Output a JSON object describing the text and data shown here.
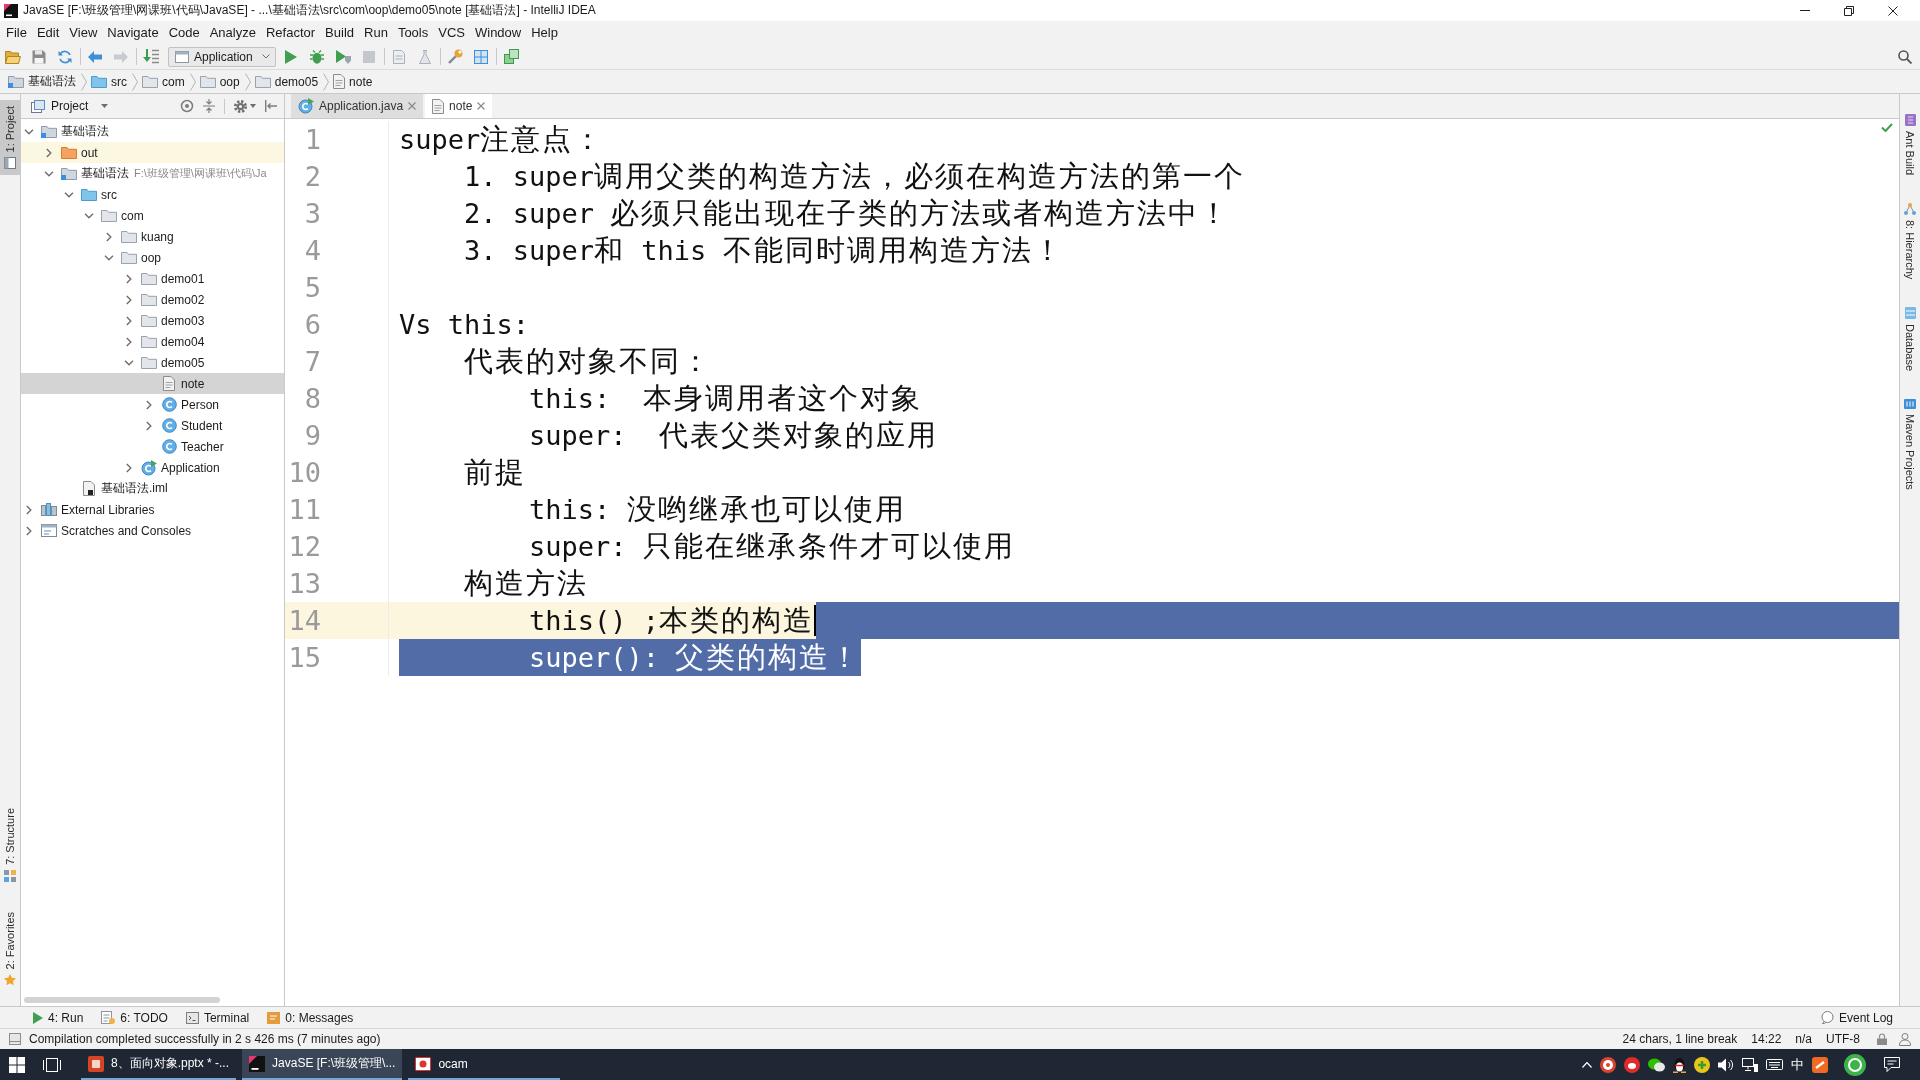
{
  "window": {
    "title": "JavaSE [F:\\班级管理\\网课班\\代码\\JavaSE] - ...\\基础语法\\src\\com\\oop\\demo05\\note [基础语法] - IntelliJ IDEA"
  },
  "menu": [
    "File",
    "Edit",
    "View",
    "Navigate",
    "Code",
    "Analyze",
    "Refactor",
    "Build",
    "Run",
    "Tools",
    "VCS",
    "Window",
    "Help"
  ],
  "toolbar": {
    "run_configuration": "Application"
  },
  "breadcrumbs": [
    {
      "label": "基础语法",
      "kind": "module"
    },
    {
      "label": "src",
      "kind": "source-folder"
    },
    {
      "label": "com",
      "kind": "folder"
    },
    {
      "label": "oop",
      "kind": "folder"
    },
    {
      "label": "demo05",
      "kind": "folder"
    },
    {
      "label": "note",
      "kind": "text-file"
    }
  ],
  "left_strip": {
    "top": [
      {
        "label": "1: Project",
        "kind": "project",
        "selected": true
      }
    ],
    "bottom": [
      {
        "label": "7: Structure",
        "kind": "structure",
        "selected": false
      },
      {
        "label": "2: Favorites",
        "kind": "favorites",
        "selected": false
      }
    ]
  },
  "project_panel": {
    "title": "Project",
    "tree": [
      {
        "label": "基础语法",
        "kind": "module",
        "selected": false,
        "expanded": true,
        "children": [
          {
            "label": "out",
            "kind": "excluded-folder",
            "selected": false,
            "expanded": false
          },
          {
            "label": "基础语法",
            "path": "F:\\班级管理\\网课班\\代码\\Ja",
            "kind": "module",
            "selected": false,
            "expanded": true,
            "children": [
              {
                "label": "src",
                "kind": "source-folder",
                "selected": false,
                "expanded": true,
                "children": [
                  {
                    "label": "com",
                    "kind": "folder",
                    "selected": false,
                    "expanded": true,
                    "children": [
                      {
                        "label": "kuang",
                        "kind": "folder",
                        "selected": false,
                        "expanded": false
                      },
                      {
                        "label": "oop",
                        "kind": "folder",
                        "selected": false,
                        "expanded": true,
                        "children": [
                          {
                            "label": "demo01",
                            "kind": "folder",
                            "selected": false,
                            "expanded": false
                          },
                          {
                            "label": "demo02",
                            "kind": "folder",
                            "selected": false,
                            "expanded": false
                          },
                          {
                            "label": "demo03",
                            "kind": "folder",
                            "selected": false,
                            "expanded": false
                          },
                          {
                            "label": "demo04",
                            "kind": "folder",
                            "selected": false,
                            "expanded": false
                          },
                          {
                            "label": "demo05",
                            "kind": "folder",
                            "selected": false,
                            "expanded": true,
                            "children": [
                              {
                                "label": "note",
                                "kind": "text-file",
                                "selected": true
                              },
                              {
                                "label": "Person",
                                "kind": "class",
                                "selected": false,
                                "expanded": false
                              },
                              {
                                "label": "Student",
                                "kind": "class",
                                "selected": false,
                                "expanded": false
                              },
                              {
                                "label": "Teacher",
                                "kind": "class",
                                "selected": false
                              }
                            ]
                          },
                          {
                            "label": "Application",
                            "kind": "main-class",
                            "selected": false,
                            "expanded": false
                          }
                        ]
                      }
                    ]
                  }
                ]
              },
              {
                "label": "基础语法.iml",
                "kind": "iml-file",
                "selected": false
              }
            ]
          }
        ]
      },
      {
        "label": "External Libraries",
        "kind": "libraries",
        "selected": false,
        "expanded": false
      },
      {
        "label": "Scratches and Consoles",
        "kind": "scratches",
        "selected": false,
        "expanded": false
      }
    ]
  },
  "editor": {
    "tabs": [
      {
        "label": "Application.java",
        "kind": "main-class",
        "selected": false
      },
      {
        "label": "note",
        "kind": "text-file",
        "selected": true
      }
    ],
    "lines": [
      {
        "number": "1",
        "text": "super注意点：",
        "current": false,
        "selected": false,
        "line_break_selected": false,
        "children": [
          {
            "number": "2",
            "text": "1. super调用父类的构造方法，必须在构造方法的第一个",
            "current": false,
            "selected": false,
            "line_break_selected": false
          },
          {
            "number": "3",
            "text": "2. super 必须只能出现在子类的方法或者构造方法中！",
            "current": false,
            "selected": false,
            "line_break_selected": false
          },
          {
            "number": "4",
            "text": "3. super和 this 不能同时调用构造方法！",
            "current": false,
            "selected": false,
            "line_break_selected": false
          }
        ]
      },
      {
        "number": "5",
        "current": false,
        "selected": false,
        "line_break_selected": false
      },
      {
        "number": "6",
        "text": "Vs this:",
        "current": false,
        "selected": false,
        "line_break_selected": false,
        "children": [
          {
            "number": "7",
            "text": "代表的对象不同：",
            "current": false,
            "selected": false,
            "line_break_selected": false,
            "children": [
              {
                "number": "8",
                "text": "this:  本身调用者这个对象",
                "current": false,
                "selected": false,
                "line_break_selected": false
              },
              {
                "number": "9",
                "text": "super:  代表父类对象的应用",
                "current": false,
                "selected": false,
                "line_break_selected": false
              }
            ]
          },
          {
            "number": "10",
            "text": "前提",
            "current": false,
            "selected": false,
            "line_break_selected": false,
            "children": [
              {
                "number": "11",
                "text": "this: 没哟继承也可以使用",
                "current": false,
                "selected": false,
                "line_break_selected": false
              },
              {
                "number": "12",
                "text": "super: 只能在继承条件才可以使用",
                "current": false,
                "selected": false,
                "line_break_selected": false
              }
            ]
          },
          {
            "number": "13",
            "text": "构造方法",
            "current": false,
            "selected": false,
            "line_break_selected": false,
            "children": [
              {
                "number": "14",
                "text": "this() ;本类的构造",
                "current": true,
                "selected": false,
                "line_break_selected": true
              },
              {
                "number": "15",
                "text": "super(): 父类的构造！",
                "current": false,
                "selected": true,
                "line_break_selected": false
              }
            ]
          }
        ]
      }
    ]
  },
  "right_strip": [
    {
      "label": "Ant Build",
      "kind": "ant"
    },
    {
      "label": "8: Hierarchy",
      "kind": "hierarchy"
    },
    {
      "label": "Database",
      "kind": "database"
    },
    {
      "label": "Maven Projects",
      "kind": "maven"
    }
  ],
  "tool_window_bar": {
    "left": [
      {
        "label": "4: Run",
        "kind": "run"
      },
      {
        "label": "6: TODO",
        "kind": "todo"
      },
      {
        "label": "Terminal",
        "kind": "terminal"
      },
      {
        "label": "0: Messages",
        "kind": "messages"
      }
    ],
    "right": [
      {
        "label": "Event Log",
        "kind": "event-log"
      }
    ]
  },
  "status_bar": {
    "message": "Compilation completed successfully in 2 s 426 ms (7 minutes ago)",
    "selection_info": "24 chars, 1 line break",
    "position": "14:22",
    "line_separator": "n/a",
    "encoding": "UTF-8"
  },
  "taskbar": {
    "apps": [
      {
        "label": "8、面向对象.pptx * -...",
        "kind": "powerpoint",
        "selected": false
      },
      {
        "label": "JavaSE [F:\\班级管理\\...",
        "kind": "intellij",
        "selected": true
      },
      {
        "label": "ocam",
        "kind": "ocam",
        "selected": false
      }
    ],
    "input_method": "中"
  }
}
